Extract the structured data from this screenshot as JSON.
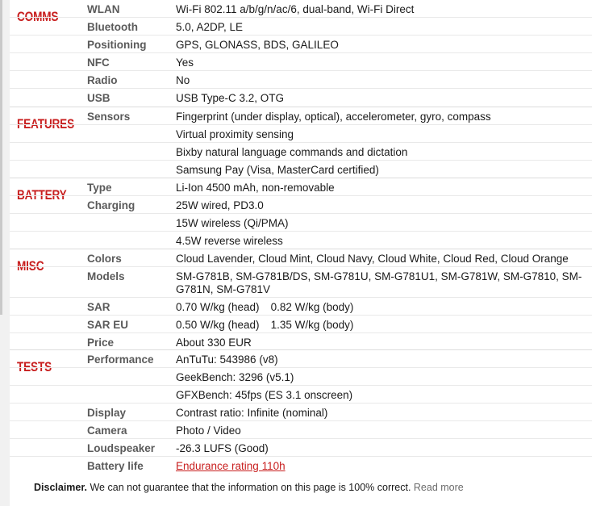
{
  "sections": [
    {
      "category": "COMMS",
      "rows": [
        {
          "title": "WLAN",
          "value": "Wi-Fi 802.11 a/b/g/n/ac/6, dual-band, Wi-Fi Direct"
        },
        {
          "title": "Bluetooth",
          "value": "5.0, A2DP, LE"
        },
        {
          "title": "Positioning",
          "value": "GPS, GLONASS, BDS, GALILEO"
        },
        {
          "title": "NFC",
          "value": "Yes"
        },
        {
          "title": "Radio",
          "value": "No"
        },
        {
          "title": "USB",
          "value": "USB Type-C 3.2, OTG"
        }
      ]
    },
    {
      "category": "FEATURES",
      "rows": [
        {
          "title": "Sensors",
          "value": "Fingerprint (under display, optical), accelerometer, gyro, compass"
        },
        {
          "title": "",
          "value": "Virtual proximity sensing"
        },
        {
          "title": "",
          "value": "Bixby natural language commands and dictation"
        },
        {
          "title": "",
          "value": "Samsung Pay (Visa, MasterCard certified)"
        }
      ]
    },
    {
      "category": "BATTERY",
      "rows": [
        {
          "title": "Type",
          "value": "Li-Ion 4500 mAh, non-removable"
        },
        {
          "title": "Charging",
          "value": "25W wired, PD3.0"
        },
        {
          "title": "",
          "value": "15W wireless (Qi/PMA)"
        },
        {
          "title": "",
          "value": "4.5W reverse wireless"
        }
      ]
    },
    {
      "category": "MISC",
      "rows": [
        {
          "title": "Colors",
          "value": "Cloud Lavender, Cloud Mint, Cloud Navy, Cloud White, Cloud Red, Cloud Orange"
        },
        {
          "title": "Models",
          "value": "SM-G781B, SM-G781B/DS, SM-G781U, SM-G781U1, SM-G781W, SM-G7810, SM-G781N, SM-G781V"
        },
        {
          "title": "SAR",
          "value": "0.70 W/kg (head)",
          "value2": "0.82 W/kg (body)"
        },
        {
          "title": "SAR EU",
          "value": "0.50 W/kg (head)",
          "value2": "1.35 W/kg (body)"
        },
        {
          "title": "Price",
          "value": "About 330 EUR"
        }
      ]
    },
    {
      "category": "TESTS",
      "rows": [
        {
          "title": "Performance",
          "value": "AnTuTu: 543986 (v8)"
        },
        {
          "title": "",
          "value": "GeekBench: 3296 (v5.1)"
        },
        {
          "title": "",
          "value": "GFXBench: 45fps (ES 3.1 onscreen)"
        },
        {
          "title": "Display",
          "value": "Contrast ratio: Infinite (nominal)"
        },
        {
          "title": "Camera",
          "value": "Photo / Video"
        },
        {
          "title": "Loudspeaker",
          "value": "-26.3 LUFS (Good)"
        },
        {
          "title": "Battery life",
          "value": "Endurance rating 110h",
          "link": true
        }
      ]
    }
  ],
  "disclaimer": {
    "label": "Disclaimer.",
    "text": " We can not guarantee that the information on this page is 100% correct. ",
    "read_more": "Read more"
  }
}
